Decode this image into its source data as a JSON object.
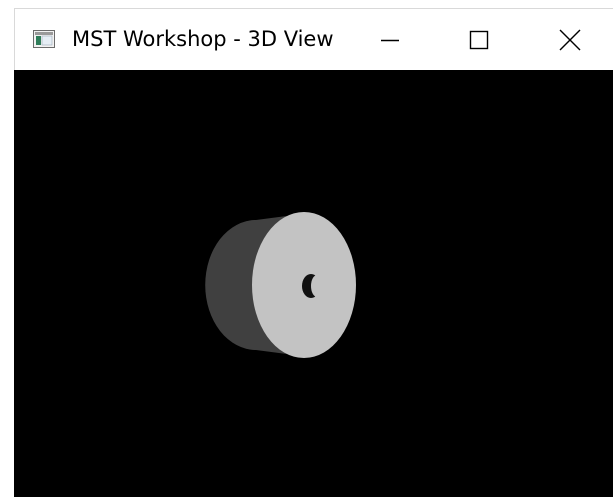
{
  "window": {
    "title": "MST Workshop - 3D View"
  },
  "controls": {
    "minimize_icon": "minimize-icon",
    "maximize_icon": "maximize-icon",
    "close_icon": "close-icon"
  },
  "viewport": {
    "background_color": "#000000",
    "object": {
      "shape": "cylinder",
      "face_color": "#c3c3c3",
      "side_color": "#404040"
    }
  }
}
